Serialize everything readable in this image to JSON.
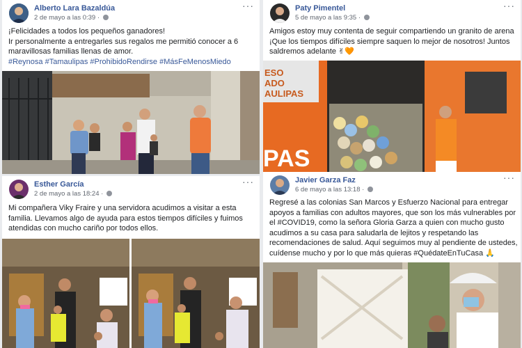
{
  "posts": [
    {
      "author": "Alberto Lara Bazaldúa",
      "date": "2 de mayo a las 0:39",
      "more": "···",
      "lines": [
        "¡Felicidades a todos los pequeños ganadores!",
        "Ir personalmente a entregarles sus regalos me permitió conocer a 6",
        "maravillosas familias llenas de amor."
      ],
      "hashtags": "#Reynosa #Tamaulipas #ProhibidoRendirse #MásFeMenosMiedo"
    },
    {
      "author": "Paty Pimentel",
      "date": "5 de mayo a las 9:35",
      "more": "···",
      "lines": [
        "Amigos estoy muy contenta de seguir compartiendo un granito de arena",
        "¡Que los tiempos difíciles siempre saquen lo mejor de nosotros! Juntos",
        "saldremos adelante ✌🧡"
      ],
      "van_text": {
        "line1": "ESO",
        "line2": "ADO",
        "line3": "AULIPAS",
        "side": "PAS"
      }
    },
    {
      "author": "Esther García",
      "date": "2 de mayo a las 18:24",
      "more": "···",
      "lines": [
        "Mi compañera Viky Fraire y una servidora acudimos a visitar a esta",
        "familia. Llevamos algo de ayuda para estos tiempos difíciles y fuimos",
        "atendidas con mucho cariño por todos ellos."
      ]
    },
    {
      "author": "Javier Garza Faz",
      "date": "6 de mayo a las 13:18",
      "more": "···",
      "lines": [
        "Regresé a las colonias San Marcos y Esfuerzo Nacional para entregar",
        "apoyos a familias con adultos mayores, que son los más vulnerables por",
        "el #COVID19, como la señora Gloria Garza a quien con mucho gusto",
        "acudimos a su casa para saludarla de lejitos y respetando las",
        "recomendaciones de salud. Aquí seguimos muy al pendiente de ustedes,",
        "cuídense mucho y por lo que más quieras #QuédateEnTuCasa 🙏"
      ]
    }
  ]
}
